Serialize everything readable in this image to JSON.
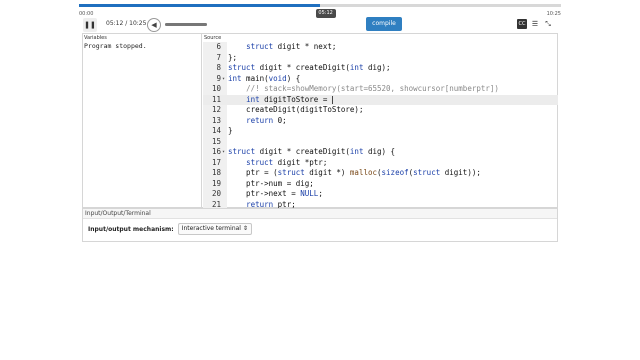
{
  "timeline": {
    "start_label": "00:00",
    "end_label": "10:25",
    "current_bubble": "05:12",
    "progress": 0.4992
  },
  "controls": {
    "play_icon": "pause-icon",
    "time_readout": "05:12 / 10:25",
    "volume_icon": "speaker-icon",
    "volume_level": 1.0,
    "compile_label": "compile",
    "cc_label": "CC",
    "right_icons": [
      "captions-icon",
      "list-icon",
      "collapse-icon"
    ]
  },
  "variables": {
    "header": "Variables",
    "output": "Program stopped."
  },
  "source": {
    "header": "Source",
    "highlight_line": "11",
    "lines": [
      {
        "num": "6",
        "fold": "",
        "text": "    struct digit * next;"
      },
      {
        "num": "7",
        "fold": "",
        "text": "};"
      },
      {
        "num": "8",
        "fold": "",
        "text": "struct digit * createDigit(int dig);"
      },
      {
        "num": "9",
        "fold": "▾",
        "text": "int main(void) {"
      },
      {
        "num": "10",
        "fold": "",
        "text": "    //! stack=showMemory(start=65520, showcursor[numberptr])"
      },
      {
        "num": "11",
        "fold": "",
        "text": "    int digitToStore = "
      },
      {
        "num": "12",
        "fold": "",
        "text": "    createDigit(digitToStore);"
      },
      {
        "num": "13",
        "fold": "",
        "text": "    return 0;"
      },
      {
        "num": "14",
        "fold": "",
        "text": "}"
      },
      {
        "num": "15",
        "fold": "",
        "text": ""
      },
      {
        "num": "16",
        "fold": "▾",
        "text": "struct digit * createDigit(int dig) {"
      },
      {
        "num": "17",
        "fold": "",
        "text": "    struct digit *ptr;"
      },
      {
        "num": "18",
        "fold": "",
        "text": "    ptr = (struct digit *) malloc(sizeof(struct digit));"
      },
      {
        "num": "19",
        "fold": "",
        "text": "    ptr->num = dig;"
      },
      {
        "num": "20",
        "fold": "",
        "text": "    ptr->next = NULL;"
      },
      {
        "num": "21",
        "fold": "",
        "text": "    return ptr;"
      }
    ]
  },
  "io": {
    "header": "Input/Output/Terminal",
    "label": "Input/output mechanism:",
    "selected": "Interactive terminal"
  }
}
